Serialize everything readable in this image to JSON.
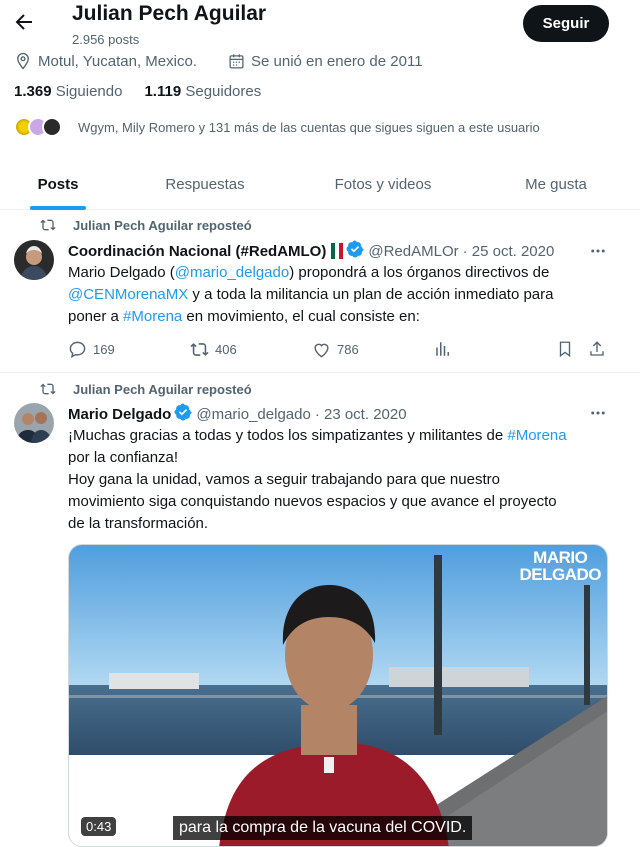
{
  "header": {
    "name": "Julian Pech Aguilar",
    "posts_count": "2.956 posts",
    "follow_label": "Seguir"
  },
  "profile": {
    "location": "Motul, Yucatan, Mexico.",
    "joined": "Se unió en enero de 2011",
    "following_count": "1.369",
    "following_label": "Siguiendo",
    "followers_count": "1.119",
    "followers_label": "Seguidores",
    "followers_you_know": "Wgym, Mily Romero y 131 más de las cuentas que sigues siguen a este usuario"
  },
  "tabs": [
    {
      "label": "Posts",
      "active": true
    },
    {
      "label": "Respuestas",
      "active": false
    },
    {
      "label": "Fotos y videos",
      "active": false
    },
    {
      "label": "Me gusta",
      "active": false
    }
  ],
  "posts": [
    {
      "repost_label": "Julian Pech Aguilar reposteó",
      "author": "Coordinación Nacional (#RedAMLO)",
      "handle": "@RedAMLOr",
      "date": "· 25 oct. 2020",
      "text": {
        "l1a": "Mario Delgado  (",
        "l1b": "@mario_delgado",
        "l1c": ") propondrá a los órganos directivos de",
        "l2a": "@CENMorenaMX",
        "l2b": " y a toda la militancia un plan de acción inmediato para",
        "l3a": "poner a ",
        "l3b": "#Morena",
        "l3c": " en movimiento, el cual consiste en:"
      },
      "replies": "169",
      "reposts": "406",
      "likes": "786"
    },
    {
      "repost_label": "Julian Pech Aguilar reposteó",
      "author": "Mario Delgado",
      "handle": "@mario_delgado",
      "date": "· 23 oct. 2020",
      "text": {
        "l1a": "¡Muchas gracias a todas y todos los simpatizantes y militantes de ",
        "l1b": "#Morena",
        "l2": "por la confianza!",
        "l3": "Hoy gana la unidad, vamos a seguir trabajando para que nuestro",
        "l4": "movimiento siga conquistando nuevos espacios y que avance el proyecto",
        "l5": "de la transformación."
      },
      "video": {
        "duration": "0:43",
        "caption": "para la compra de la vacuna del COVID.",
        "brand_line1": "MARIO",
        "brand_line2": "DELGADO"
      }
    }
  ],
  "colors": {
    "accent": "#1d9bf0",
    "text": "#0f1419",
    "secondary": "#536471",
    "follow_bg": "#0f1419"
  }
}
